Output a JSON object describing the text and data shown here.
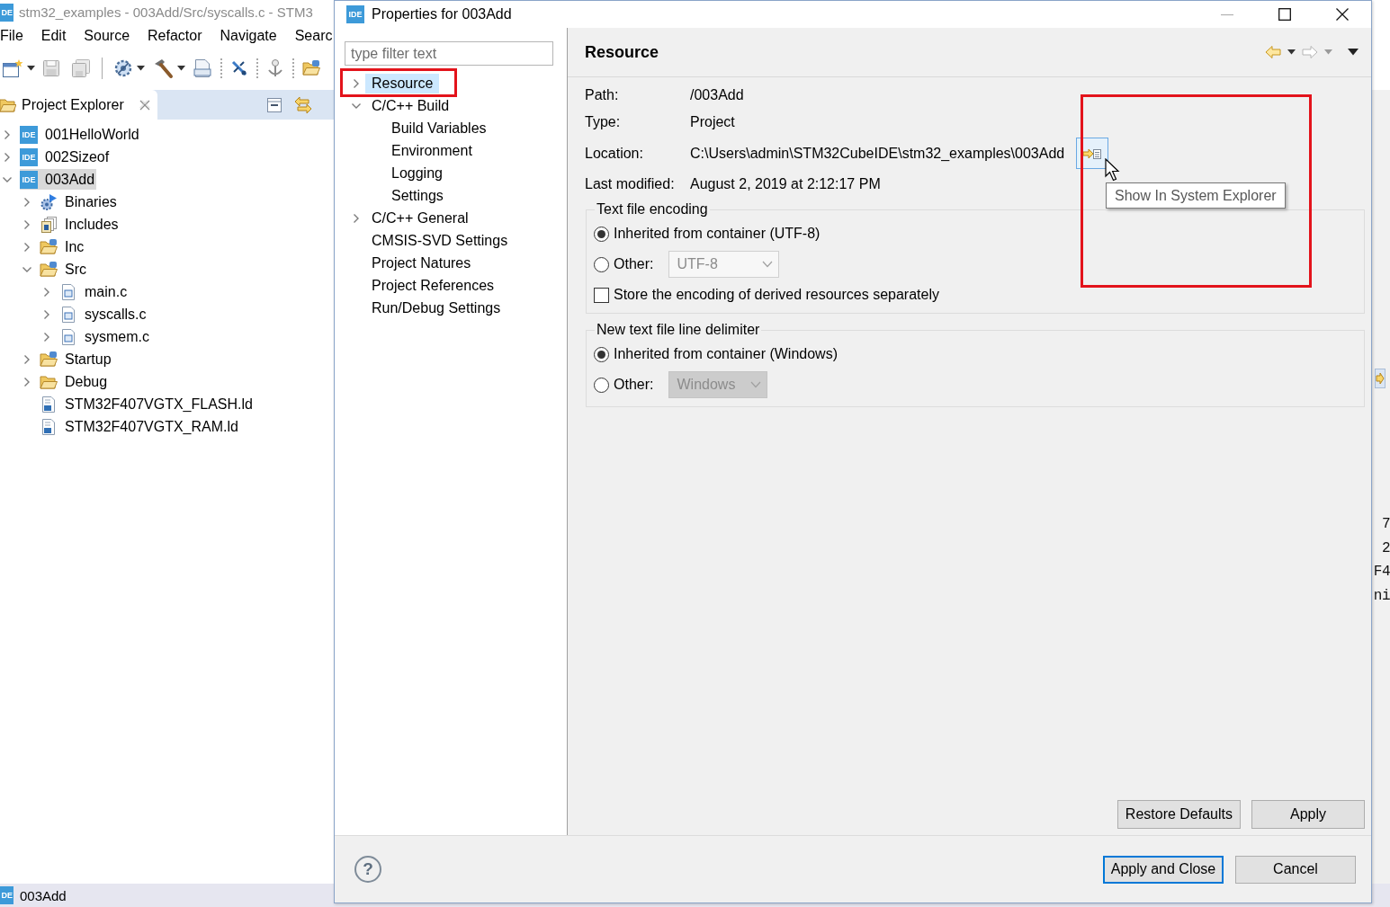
{
  "ide_window": {
    "logo_text": "DE",
    "title": "stm32_examples - 003Add/Src/syscalls.c - STM3",
    "menu": [
      "File",
      "Edit",
      "Source",
      "Refactor",
      "Navigate",
      "Searc"
    ],
    "project_explorer": {
      "tab_label": "Project Explorer",
      "items": [
        {
          "label": "001HelloWorld",
          "kind": "project",
          "logo_text": "IDE",
          "expanded": false,
          "selected": false
        },
        {
          "label": "002Sizeof",
          "kind": "project",
          "logo_text": "IDE",
          "expanded": false,
          "selected": false
        },
        {
          "label": "003Add",
          "kind": "project",
          "logo_text": "IDE",
          "expanded": true,
          "selected": true,
          "children": [
            {
              "label": "Binaries",
              "kind": "binaries",
              "expanded": false,
              "selected": false
            },
            {
              "label": "Includes",
              "kind": "includes",
              "expanded": false,
              "selected": false
            },
            {
              "label": "Inc",
              "kind": "source-folder",
              "expanded": false,
              "selected": false
            },
            {
              "label": "Src",
              "kind": "source-folder",
              "expanded": true,
              "selected": false,
              "children": [
                {
                  "label": "main.c",
                  "kind": "c-file",
                  "expanded": false,
                  "selected": false
                },
                {
                  "label": "syscalls.c",
                  "kind": "c-file",
                  "expanded": false,
                  "selected": false
                },
                {
                  "label": "sysmem.c",
                  "kind": "c-file",
                  "expanded": false,
                  "selected": false
                }
              ]
            },
            {
              "label": "Startup",
              "kind": "source-folder",
              "expanded": false,
              "selected": false
            },
            {
              "label": "Debug",
              "kind": "folder",
              "expanded": false,
              "selected": false
            },
            {
              "label": "STM32F407VGTX_FLASH.ld",
              "kind": "linker-file",
              "selected": false
            },
            {
              "label": "STM32F407VGTX_RAM.ld",
              "kind": "linker-file",
              "selected": false
            }
          ]
        }
      ]
    },
    "editor_fragments": [
      "7",
      "2",
      "F4",
      "ni"
    ],
    "status_bar": {
      "logo_text": "DE",
      "text": "003Add"
    }
  },
  "dialog": {
    "logo_text": "IDE",
    "title": "Properties for 003Add",
    "filter": {
      "placeholder": "type filter text"
    },
    "nav": [
      {
        "label": "Resource",
        "expanded": false,
        "selected": true
      },
      {
        "label": "C/C++ Build",
        "expanded": true,
        "selected": false,
        "children": [
          {
            "label": "Build Variables",
            "selected": false
          },
          {
            "label": "Environment",
            "selected": false
          },
          {
            "label": "Logging",
            "selected": false
          },
          {
            "label": "Settings",
            "selected": false
          }
        ]
      },
      {
        "label": "C/C++ General",
        "expanded": false,
        "selected": false
      },
      {
        "label": "CMSIS-SVD Settings",
        "selected": false
      },
      {
        "label": "Project Natures",
        "selected": false
      },
      {
        "label": "Project References",
        "selected": false
      },
      {
        "label": "Run/Debug Settings",
        "selected": false
      }
    ],
    "page": {
      "title": "Resource",
      "navigation": [
        {
          "kind": "back",
          "disabled": false
        },
        {
          "kind": "forward",
          "disabled": true
        }
      ],
      "properties": [
        {
          "kind": "text",
          "label": "Path:",
          "value": "/003Add"
        },
        {
          "kind": "text",
          "label": "Type:",
          "value": "Project"
        },
        {
          "kind": "location",
          "label": "Location:",
          "value": "C:\\Users\\admin\\STM32CubeIDE\\stm32_examples\\003Add"
        },
        {
          "kind": "text",
          "label": "Last modified:",
          "value": "August 2, 2019 at 2:12:17 PM"
        }
      ],
      "tooltip": "Show In System Explorer",
      "groups": [
        {
          "title": "Text file encoding",
          "options": [
            {
              "kind": "radio",
              "label": "Inherited from container (UTF-8)",
              "selected": true
            },
            {
              "kind": "radio",
              "label": "Other:",
              "selected": false,
              "combo": {
                "kind": "editable",
                "value": "UTF-8",
                "disabled": true
              }
            },
            {
              "kind": "checkbox",
              "label": "Store the encoding of derived resources separately",
              "checked": false
            }
          ]
        },
        {
          "title": "New text file line delimiter",
          "options": [
            {
              "kind": "radio",
              "label": "Inherited from container (Windows)",
              "selected": true
            },
            {
              "kind": "radio",
              "label": "Other:",
              "selected": false,
              "combo": {
                "kind": "readonly",
                "value": "Windows",
                "disabled": true
              }
            }
          ]
        }
      ],
      "buttons": [
        "Restore Defaults",
        "Apply"
      ]
    },
    "help_button": "?",
    "footer_buttons": [
      {
        "label": "Apply and Close",
        "default": true
      },
      {
        "label": "Cancel",
        "default": false
      }
    ]
  }
}
